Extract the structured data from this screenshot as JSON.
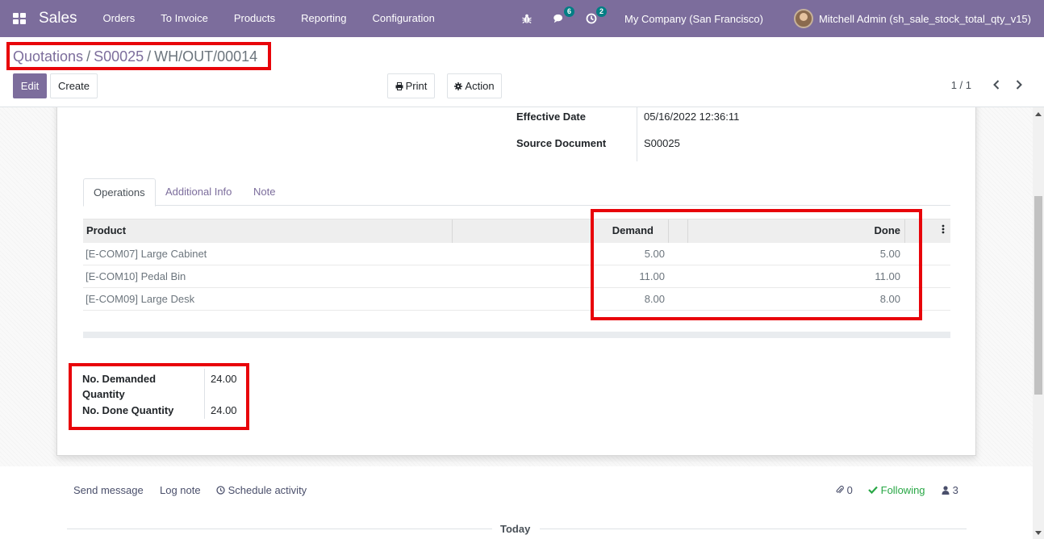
{
  "navbar": {
    "brand": "Sales",
    "menu": [
      "Orders",
      "To Invoice",
      "Products",
      "Reporting",
      "Configuration"
    ],
    "messages_badge": "6",
    "activities_badge": "2",
    "company": "My Company (San Francisco)",
    "user": "Mitchell Admin (sh_sale_stock_total_qty_v15)"
  },
  "control_panel": {
    "breadcrumb": [
      "Quotations",
      "S00025",
      "WH/OUT/00014"
    ],
    "edit_label": "Edit",
    "create_label": "Create",
    "print_label": "Print",
    "action_label": "Action",
    "pager": "1 / 1"
  },
  "form": {
    "effective_date_label": "Effective Date",
    "effective_date_value": "05/16/2022 12:36:11",
    "source_document_label": "Source Document",
    "source_document_value": "S00025"
  },
  "tabs": [
    "Operations",
    "Additional Info",
    "Note"
  ],
  "table": {
    "headers": {
      "product": "Product",
      "demand": "Demand",
      "done": "Done"
    },
    "rows": [
      {
        "product": "[E-COM07] Large Cabinet",
        "demand": "5.00",
        "done": "5.00"
      },
      {
        "product": "[E-COM10] Pedal Bin",
        "demand": "11.00",
        "done": "11.00"
      },
      {
        "product": "[E-COM09] Large Desk",
        "demand": "8.00",
        "done": "8.00"
      }
    ]
  },
  "totals": {
    "demanded_label_1": "No. Demanded",
    "demanded_label_2": "Quantity",
    "demanded_value": "24.00",
    "done_label": "No. Done Quantity",
    "done_value": "24.00"
  },
  "chatter": {
    "send_message": "Send message",
    "log_note": "Log note",
    "schedule_activity": "Schedule activity",
    "attachments": "0",
    "following": "Following",
    "followers": "3",
    "today": "Today"
  },
  "colors": {
    "brand": "#7c6d9c",
    "highlight": "#e8040a",
    "badge": "#017e84",
    "following": "#28a745"
  }
}
